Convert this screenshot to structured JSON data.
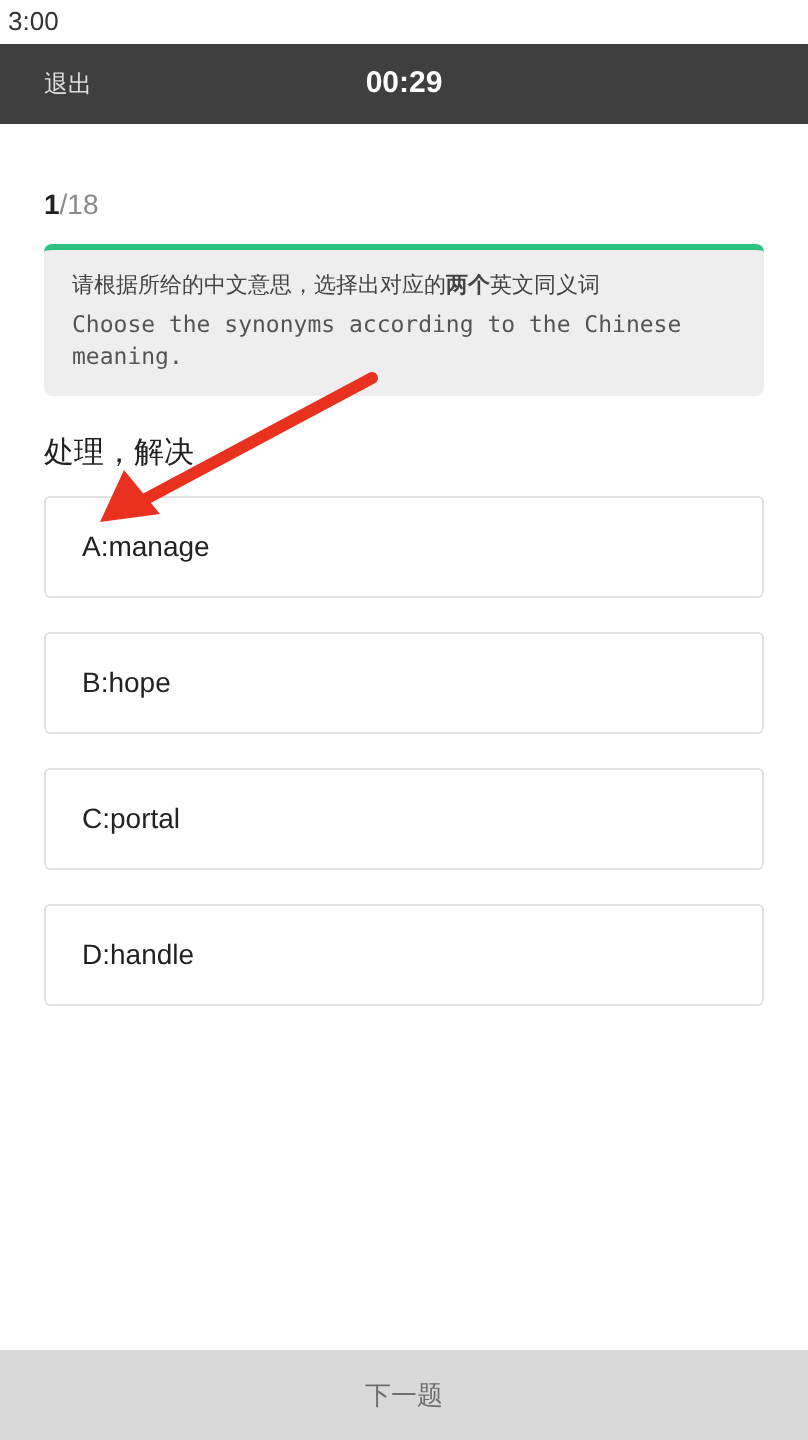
{
  "status_bar": {
    "time": "3:00"
  },
  "header": {
    "exit": "退出",
    "timer": "00:29"
  },
  "progress": {
    "current": "1",
    "total": "/18"
  },
  "instruction": {
    "chinese": "请根据所给的中文意思，选择出对应的**两个**英文同义词",
    "english": "Choose the synonyms according to the Chinese meaning."
  },
  "prompt": "处理，解决",
  "options": [
    {
      "label": "A:manage",
      "selected": false
    },
    {
      "label": "B:hope",
      "selected": false
    },
    {
      "label": "C:portal",
      "selected": false
    },
    {
      "label": "D:handle",
      "selected": false
    }
  ],
  "next_button": {
    "label": "下一题",
    "disabled": true
  }
}
